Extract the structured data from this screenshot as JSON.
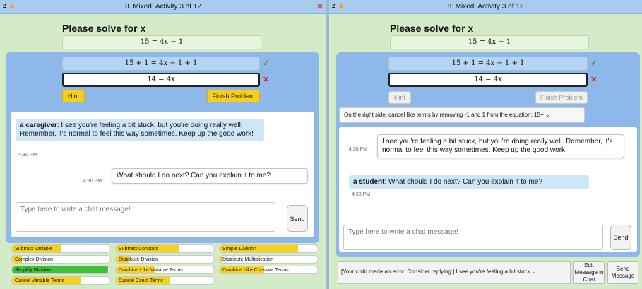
{
  "left": {
    "titlebar": {
      "num": "2",
      "title": "8. Mixed: Activity 3 of 12",
      "close": "✕"
    },
    "heading": "Please solve for x",
    "equation": "15 = 4x − 1",
    "steps": [
      {
        "text": "15 + 1 = 4x − 1 + 1",
        "mark": "✓"
      },
      {
        "text": "14 = 4x",
        "mark": "✕"
      }
    ],
    "hint_label": "Hint",
    "finish_label": "Finish Problem",
    "chat": {
      "msg1_sender": "a caregiver",
      "msg1_text": ": I see you're feeling a bit stuck, but you're doing really well. Remember, it's normal to feel this way sometimes. Keep up the good work!",
      "msg1_time": "4:30 PM",
      "msg2_time": "4:30 PM",
      "msg2_text": "What should I do next? Can you explain it to me?",
      "input_placeholder": "Type here to write a chat message!",
      "send_label": "Send"
    },
    "skills": [
      {
        "label": "Subtract Variable",
        "fill": 0.5,
        "color": "y"
      },
      {
        "label": "Subtract Constant",
        "fill": 0.65,
        "color": "y"
      },
      {
        "label": "Simple Division",
        "fill": 0.8,
        "color": "y"
      },
      {
        "label": "Complex Division",
        "fill": 0.1,
        "color": "y"
      },
      {
        "label": "Distribute Division",
        "fill": 0.13,
        "color": "y"
      },
      {
        "label": "Distribute Multiplication",
        "fill": 0.02,
        "color": "y"
      },
      {
        "label": "Simplify Division",
        "fill": 0.98,
        "color": "g"
      },
      {
        "label": "Combine Like Variable Terms",
        "fill": 0.4,
        "color": "y"
      },
      {
        "label": "Combine Like Constant Terms",
        "fill": 0.45,
        "color": "y"
      },
      {
        "label": "Cancel Variable Terms",
        "fill": 0.7,
        "color": "y"
      },
      {
        "label": "Cancel Const Terms",
        "fill": 0.55,
        "color": "y"
      }
    ]
  },
  "right": {
    "titlebar": {
      "num": "2",
      "title": "8. Mixed: Activity 3 of 12"
    },
    "heading": "Please solve for x",
    "equation": "15 = 4x − 1",
    "steps": [
      {
        "text": "15 + 1 = 4x − 1 + 1",
        "mark": "✓"
      },
      {
        "text": "14 = 4x",
        "mark": "✕"
      }
    ],
    "hint_label": "Hint",
    "finish_label": "Finish Problem",
    "hint_dropdown": "On the right side, cancel like terms by removing -1 and 1 from the equation: 15+ ⌄",
    "chat": {
      "msg1_time": "4:30 PM",
      "msg1_text": "I see you're feeling a bit stuck, but you're doing really well. Remember, it's normal to feel this way sometimes. Keep up the good work!",
      "msg2_sender": "a student",
      "msg2_text": ": What should I do next? Can you explain it to me?",
      "msg2_time": "4:30 PM",
      "input_placeholder": "Type here to write a chat message!",
      "send_label": "Send"
    },
    "suggestion": "[Your child made an error. Consider replying:] I see you're feeling a bit stuck ⌄",
    "edit_label": "Edit Message in Chat",
    "send_message_label": "Send Message"
  },
  "colors": {
    "background": "#d4ebc7",
    "titlebar": "#a9cbef",
    "workspace": "#8fb8ea",
    "hint_yellow": "#f7cf1a",
    "skill_green": "#3fc03a",
    "check_green": "#2ea02e",
    "error_red": "#e02020"
  }
}
